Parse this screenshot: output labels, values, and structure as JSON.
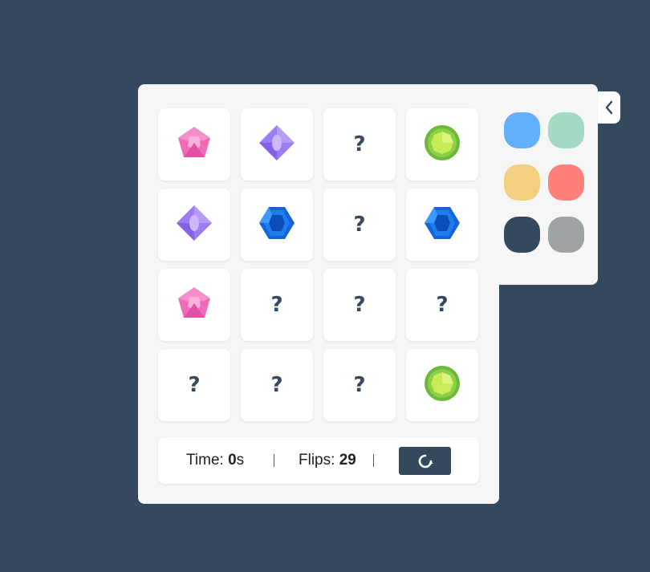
{
  "board": {
    "cards": [
      {
        "face": "gem-pink"
      },
      {
        "face": "gem-purple"
      },
      {
        "face": "hidden",
        "symbol": "?"
      },
      {
        "face": "gem-green"
      },
      {
        "face": "gem-purple"
      },
      {
        "face": "gem-blue"
      },
      {
        "face": "hidden",
        "symbol": "?"
      },
      {
        "face": "gem-blue"
      },
      {
        "face": "gem-pink"
      },
      {
        "face": "hidden",
        "symbol": "?"
      },
      {
        "face": "hidden",
        "symbol": "?"
      },
      {
        "face": "hidden",
        "symbol": "?"
      },
      {
        "face": "hidden",
        "symbol": "?"
      },
      {
        "face": "hidden",
        "symbol": "?"
      },
      {
        "face": "hidden",
        "symbol": "?"
      },
      {
        "face": "gem-green"
      }
    ]
  },
  "footer": {
    "time_label": "Time: ",
    "time_value": "0",
    "time_unit": "s",
    "flips_label": "Flips: ",
    "flips_value": "29",
    "restart_icon": "restart-icon"
  },
  "theme": {
    "swatches": [
      {
        "name": "blue",
        "color": "#64aefe"
      },
      {
        "name": "mint",
        "color": "#a4dac4"
      },
      {
        "name": "yellow",
        "color": "#f3d081"
      },
      {
        "name": "red",
        "color": "#fe8079"
      },
      {
        "name": "navy",
        "color": "#34495e"
      },
      {
        "name": "gray",
        "color": "#9ea3a6"
      }
    ],
    "toggle_icon": "chevron-left-icon"
  },
  "colors": {
    "background": "#34495e",
    "panel": "#f6f6f6",
    "card": "#ffffff",
    "accent": "#34495e"
  }
}
